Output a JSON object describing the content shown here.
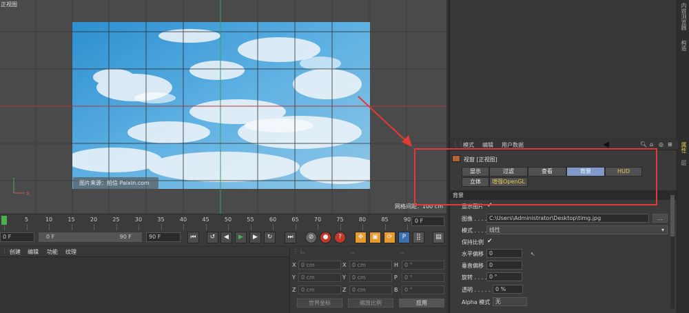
{
  "viewport": {
    "label": "正视图",
    "watermark": "图片来源：拍信 Paixin.com",
    "grid_spacing": "网格间距：100 cm"
  },
  "timeline": {
    "ticks": [
      "0",
      "5",
      "10",
      "15",
      "20",
      "25",
      "30",
      "35",
      "40",
      "45",
      "50",
      "55",
      "60",
      "65",
      "70",
      "75",
      "80",
      "85",
      "90"
    ],
    "current_frame": "0 F",
    "end_frame": "0 F"
  },
  "transport": {
    "start_field": "0 F",
    "range_start": "0 F",
    "range_end": "90 F",
    "max_field": "90 F"
  },
  "material_menu": {
    "create": "创建",
    "edit": "编辑",
    "function": "功能",
    "texture": "纹理"
  },
  "coordinates": {
    "header_labels": [
      "--",
      "--",
      "--"
    ],
    "rows": [
      {
        "a": "X",
        "av": "0 cm",
        "b": "X",
        "bv": "0 cm",
        "c": "H",
        "cv": "0 °"
      },
      {
        "a": "Y",
        "av": "0 cm",
        "b": "Y",
        "bv": "0 cm",
        "c": "P",
        "cv": "0 °"
      },
      {
        "a": "Z",
        "av": "0 cm",
        "b": "Z",
        "bv": "0 cm",
        "c": "B",
        "cv": "0 °"
      }
    ],
    "coord_mode": "世界坐标",
    "scale_mode": "缩放比例",
    "apply": "应用"
  },
  "attributes": {
    "menu": {
      "mode": "模式",
      "edit": "编辑",
      "user_data": "用户数据"
    },
    "object_title": "视窗 [正视图]",
    "tabs": {
      "display": "显示",
      "filter": "过滤",
      "view": "查看",
      "background": "背景",
      "hud": "HUD",
      "stereo": "立体",
      "opengl": "增强OpenGL"
    },
    "section": "背景",
    "show_image_label": "显示图片",
    "image_label": "图像 . . . . .",
    "image_path": "C:\\Users\\Administrator\\Desktop\\timg.jpg",
    "browse": "...",
    "mode_label": "模式 . . . . .",
    "mode_value": "线性",
    "keep_ratio_label": "保持比例",
    "h_offset_label": "水平偏移",
    "h_offset": "0",
    "v_offset_label": "垂直偏移",
    "v_offset": "0",
    "rotation_label": "旋转 . . . .",
    "rotation": "0 °",
    "transparency_label": "透明 . . . . .",
    "transparency": "0 %",
    "alpha_label": "Alpha 模式",
    "alpha_value": "无"
  },
  "side_tabs": [
    "内容浏览器",
    "构造",
    "属性",
    "层"
  ],
  "colors": {
    "annotation_red": "#e53935",
    "active_tab": "#7f9ac8",
    "playhead": "#4caf50",
    "accent_yellow": "#e8c84a"
  }
}
